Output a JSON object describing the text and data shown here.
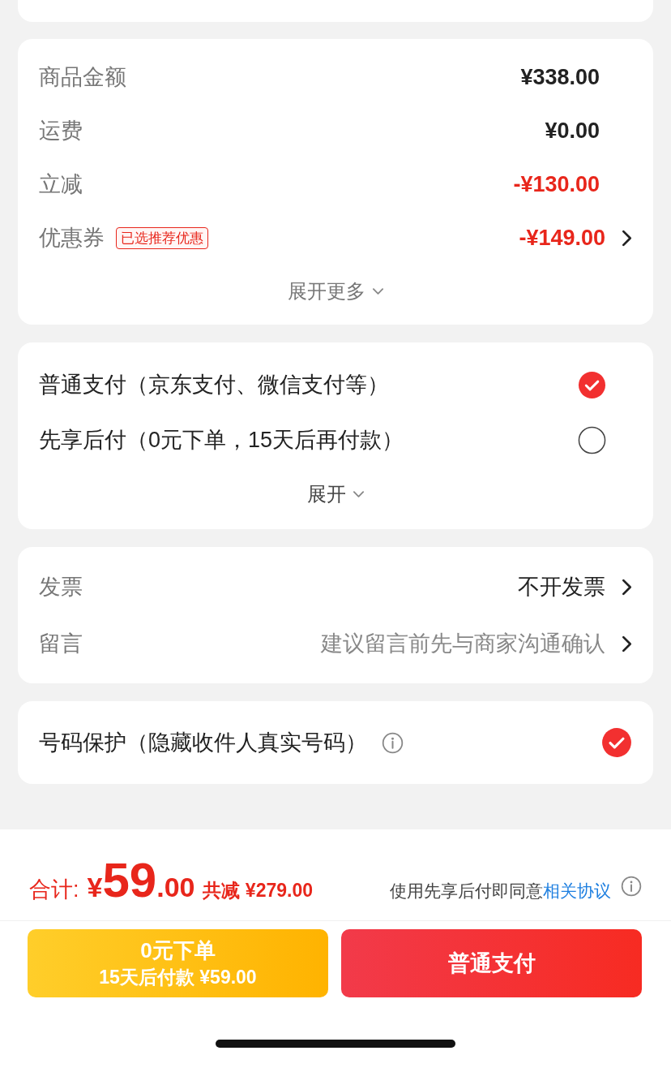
{
  "price_rows": [
    {
      "label": "商品金额",
      "amount": "¥338.00",
      "discount": false,
      "has_arrow": false
    },
    {
      "label": "运费",
      "amount": "¥0.00",
      "discount": false,
      "has_arrow": false
    },
    {
      "label": "立减",
      "amount": "-¥130.00",
      "discount": true,
      "has_arrow": false
    },
    {
      "label": "优惠券",
      "badge": "已选推荐优惠",
      "amount": "-¥149.00",
      "discount": true,
      "has_arrow": true
    }
  ],
  "price_expand": "展开更多",
  "payment_options": [
    {
      "label": "普通支付（京东支付、微信支付等）",
      "selected": true
    },
    {
      "label": "先享后付（0元下单，15天后再付款）",
      "selected": false
    }
  ],
  "payment_expand": "展开",
  "extra_rows": [
    {
      "label": "发票",
      "value": "不开发票",
      "placeholder_style": false
    },
    {
      "label": "留言",
      "value": "建议留言前先与商家沟通确认",
      "placeholder_style": true
    }
  ],
  "privacy": {
    "label": "号码保护（隐藏收件人真实号码）",
    "checked": true
  },
  "summary": {
    "prefix": "合计:",
    "currency": "¥",
    "integer": "59",
    "decimal": ".00",
    "saved": "共减 ¥279.00",
    "agreement": "使用先享后付即同意",
    "agreement_link": "相关协议"
  },
  "buttons": [
    {
      "kind": "later",
      "title": "0元下单",
      "subtitle": "15天后付款 ¥59.00"
    },
    {
      "kind": "pay",
      "title": "普通支付"
    }
  ]
}
